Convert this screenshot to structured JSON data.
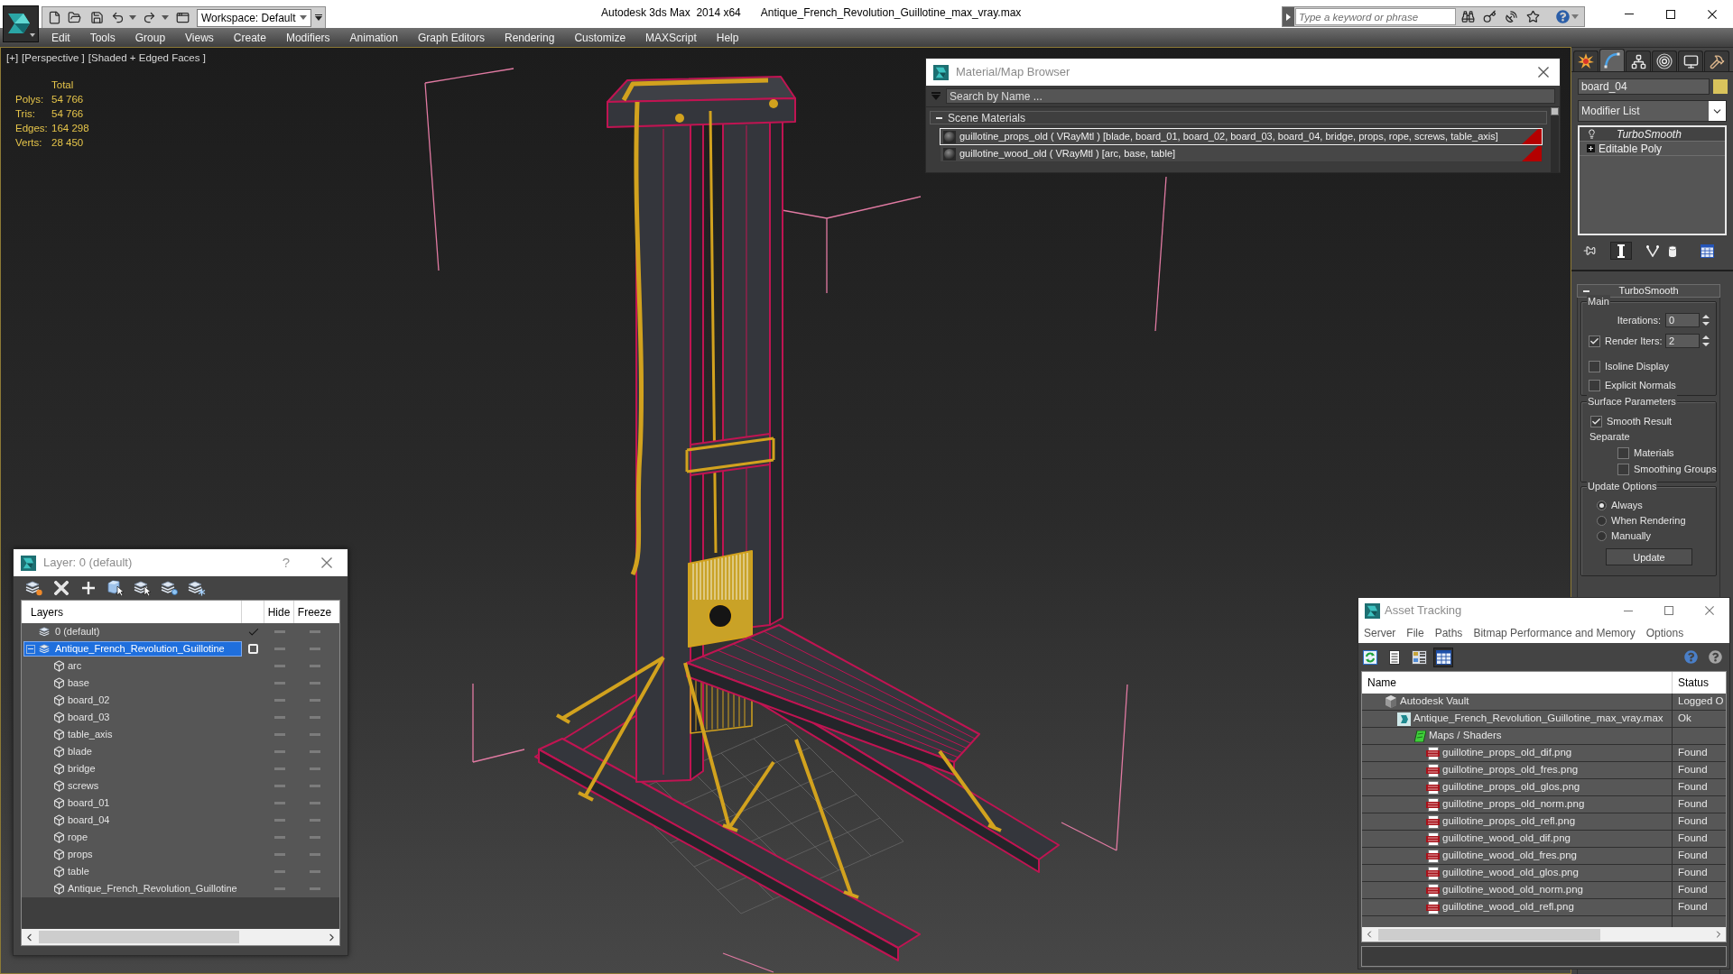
{
  "title_bar": {
    "workspace": "Workspace: Default",
    "app_title": "Autodesk 3ds Max  2014 x64",
    "file_name": "Antique_French_Revolution_Guillotine_max_vray.max",
    "search": {
      "placeholder": "Type a keyword or phrase"
    }
  },
  "menu": [
    "Edit",
    "Tools",
    "Group",
    "Views",
    "Create",
    "Modifiers",
    "Animation",
    "Graph Editors",
    "Rendering",
    "Customize",
    "MAXScript",
    "Help"
  ],
  "viewport": {
    "labels": [
      "[+]",
      "[Perspective ]",
      "[Shaded + Edged Faces ]"
    ],
    "stats_heading": "Total",
    "stats": [
      {
        "label": "Polys:",
        "value": "54 766"
      },
      {
        "label": "Tris:",
        "value": "54 766"
      },
      {
        "label": "Edges:",
        "value": "164 298"
      },
      {
        "label": "Verts:",
        "value": "28 450"
      }
    ]
  },
  "material_browser": {
    "title": "Material/Map Browser",
    "search": {
      "placeholder": "Search by Name ..."
    },
    "group": {
      "label": "Scene Materials",
      "expanded": true
    },
    "materials": [
      {
        "label": "guillotine_props_old ( VRayMtl ) [blade, board_01, board_02, board_03, board_04, bridge, props, rope, screws, table_axis]",
        "selected": true
      },
      {
        "label": "guillotine_wood_old ( VRayMtl ) [arc, base, table]",
        "selected": false
      }
    ]
  },
  "command_panel": {
    "tabs": [
      {
        "selected": false
      },
      {
        "selected": true
      },
      {
        "selected": false
      },
      {
        "selected": false
      },
      {
        "selected": false
      },
      {
        "selected": false
      }
    ],
    "object": {
      "name": "board_04",
      "color": "#d9c35c"
    },
    "modifier_list": "Modifier List",
    "stack": [
      {
        "label": "TurboSmooth",
        "kind": "modifier",
        "selected": true
      },
      {
        "label": "Editable Poly",
        "kind": "base",
        "selected": false
      }
    ],
    "stack_buttons": [
      {
        "pressed": false
      },
      {
        "pressed": true
      },
      {
        "pressed": false
      },
      {
        "pressed": false
      },
      {
        "pressed": false
      }
    ],
    "rollout": {
      "title": "TurboSmooth",
      "expanded": true,
      "main": {
        "label": "Main",
        "iterations": {
          "label": "Iterations:",
          "value": "0"
        },
        "render_iters": {
          "label": "Render Iters:",
          "checked": true,
          "value": "2"
        },
        "isoline_display": {
          "label": "Isoline Display",
          "checked": false
        },
        "explicit_normals": {
          "label": "Explicit Normals",
          "checked": false
        }
      },
      "surface": {
        "label": "Surface Parameters",
        "smooth_result": {
          "label": "Smooth Result",
          "checked": true
        },
        "separate": "Separate",
        "materials": {
          "label": "Materials",
          "checked": false
        },
        "smoothing_groups": {
          "label": "Smoothing Groups",
          "checked": false
        }
      },
      "update": {
        "label": "Update Options",
        "options": [
          {
            "label": "Always",
            "selected": true
          },
          {
            "label": "When Rendering",
            "selected": false
          },
          {
            "label": "Manually",
            "selected": false
          }
        ],
        "button": "Update"
      }
    }
  },
  "layer_dialog": {
    "title": "Layer: 0 (default)",
    "help": "?",
    "columns": {
      "name": "Layers",
      "hide": "Hide",
      "freeze": "Freeze"
    },
    "rows": [
      {
        "name": "0 (default)",
        "kind": "layer",
        "current": true,
        "selected": false,
        "hidden": false,
        "frozen": false
      },
      {
        "name": "Antique_French_Revolution_Guillotine",
        "kind": "layer",
        "current": false,
        "selected": true,
        "expanded": true,
        "hidden": false,
        "frozen": false,
        "children": [
          {
            "name": "arc",
            "kind": "object",
            "selected": false,
            "hidden": false,
            "frozen": false
          },
          {
            "name": "base",
            "kind": "object",
            "selected": false,
            "hidden": false,
            "frozen": false
          },
          {
            "name": "board_02",
            "kind": "object",
            "selected": false,
            "hidden": false,
            "frozen": false
          },
          {
            "name": "board_03",
            "kind": "object",
            "selected": false,
            "hidden": false,
            "frozen": false
          },
          {
            "name": "table_axis",
            "kind": "object",
            "selected": false,
            "hidden": false,
            "frozen": false
          },
          {
            "name": "blade",
            "kind": "object",
            "selected": false,
            "hidden": false,
            "frozen": false
          },
          {
            "name": "bridge",
            "kind": "object",
            "selected": false,
            "hidden": false,
            "frozen": false
          },
          {
            "name": "screws",
            "kind": "object",
            "selected": false,
            "hidden": false,
            "frozen": false
          },
          {
            "name": "board_01",
            "kind": "object",
            "selected": false,
            "hidden": false,
            "frozen": false
          },
          {
            "name": "board_04",
            "kind": "object",
            "selected": false,
            "hidden": false,
            "frozen": false
          },
          {
            "name": "rope",
            "kind": "object",
            "selected": false,
            "hidden": false,
            "frozen": false
          },
          {
            "name": "props",
            "kind": "object",
            "selected": false,
            "hidden": false,
            "frozen": false
          },
          {
            "name": "table",
            "kind": "object",
            "selected": false,
            "hidden": false,
            "frozen": false
          },
          {
            "name": "Antique_French_Revolution_Guillotine",
            "kind": "object",
            "selected": false,
            "hidden": false,
            "frozen": false
          }
        ]
      }
    ]
  },
  "asset_tracking": {
    "title": "Asset Tracking",
    "menu": [
      "Server",
      "File",
      "Paths",
      "Bitmap Performance and Memory",
      "Options"
    ],
    "toolbar": [
      {
        "selected": false
      },
      {
        "selected": false
      },
      {
        "selected": false
      },
      {
        "selected": true
      }
    ],
    "columns": {
      "name": "Name",
      "status": "Status"
    },
    "rows": [
      {
        "name": "Autodesk Vault",
        "kind": "vault",
        "status": "Logged O",
        "children": [
          {
            "name": "Antique_French_Revolution_Guillotine_max_vray.max",
            "kind": "scene",
            "status": "Ok",
            "children": [
              {
                "name": "Maps / Shaders",
                "kind": "folder",
                "children": [
                  {
                    "name": "guillotine_props_old_dif.png",
                    "kind": "image",
                    "status": "Found"
                  },
                  {
                    "name": "guillotine_props_old_fres.png",
                    "kind": "image",
                    "status": "Found"
                  },
                  {
                    "name": "guillotine_props_old_glos.png",
                    "kind": "image",
                    "status": "Found"
                  },
                  {
                    "name": "guillotine_props_old_norm.png",
                    "kind": "image",
                    "status": "Found"
                  },
                  {
                    "name": "guillotine_props_old_refl.png",
                    "kind": "image",
                    "status": "Found"
                  },
                  {
                    "name": "guillotine_wood_old_dif.png",
                    "kind": "image",
                    "status": "Found"
                  },
                  {
                    "name": "guillotine_wood_old_fres.png",
                    "kind": "image",
                    "status": "Found"
                  },
                  {
                    "name": "guillotine_wood_old_glos.png",
                    "kind": "image",
                    "status": "Found"
                  },
                  {
                    "name": "guillotine_wood_old_norm.png",
                    "kind": "image",
                    "status": "Found"
                  },
                  {
                    "name": "guillotine_wood_old_refl.png",
                    "kind": "image",
                    "status": "Found"
                  }
                ]
              }
            ]
          }
        ]
      }
    ]
  }
}
